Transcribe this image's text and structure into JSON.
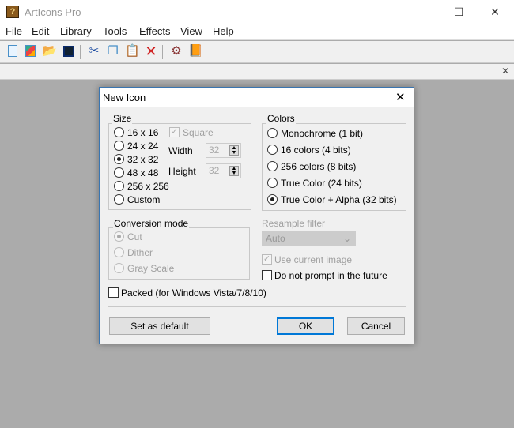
{
  "app": {
    "title": "ArtIcons Pro",
    "icon": "app-chest-icon"
  },
  "window_controls": {
    "minimize": "—",
    "maximize": "☐",
    "close": "✕"
  },
  "menu": [
    "File",
    "Edit",
    "Library",
    "Tools",
    "Effects",
    "View",
    "Help"
  ],
  "toolbar": [
    "new-icon",
    "new-image-icon",
    "open-folder-icon",
    "save-icon",
    "cut-icon",
    "copy-icon",
    "paste-icon",
    "delete-icon",
    "tool-icon",
    "library-book-icon"
  ],
  "subbar": {
    "close": "✕"
  },
  "dialog": {
    "title": "New Icon",
    "close": "✕",
    "size": {
      "label": "Size",
      "options": [
        "16 x 16",
        "24 x 24",
        "32 x 32",
        "48 x 48",
        "256 x 256",
        "Custom"
      ],
      "selected": "32 x 32",
      "square_label": "Square",
      "square_checked": true,
      "width_label": "Width",
      "width_value": "32",
      "height_label": "Height",
      "height_value": "32"
    },
    "colors": {
      "label": "Colors",
      "options": [
        "Monochrome (1 bit)",
        "16 colors (4 bits)",
        "256 colors (8 bits)",
        "True Color (24 bits)",
        "True Color + Alpha (32 bits)"
      ],
      "selected": "True Color + Alpha (32 bits)"
    },
    "conversion": {
      "label": "Conversion mode",
      "options": [
        "Cut",
        "Dither",
        "Gray Scale"
      ],
      "selected": "Cut"
    },
    "resample": {
      "label": "Resample filter",
      "value": "Auto"
    },
    "use_current_image": {
      "label": "Use current image",
      "checked": true
    },
    "do_not_prompt": {
      "label": "Do not prompt in the future",
      "checked": false
    },
    "packed": {
      "label": "Packed (for Windows Vista/7/8/10)",
      "checked": false
    },
    "buttons": {
      "set_default": "Set as default",
      "ok": "OK",
      "cancel": "Cancel"
    }
  },
  "colors": {
    "accent": "#0078d7",
    "background": "#ababab"
  }
}
